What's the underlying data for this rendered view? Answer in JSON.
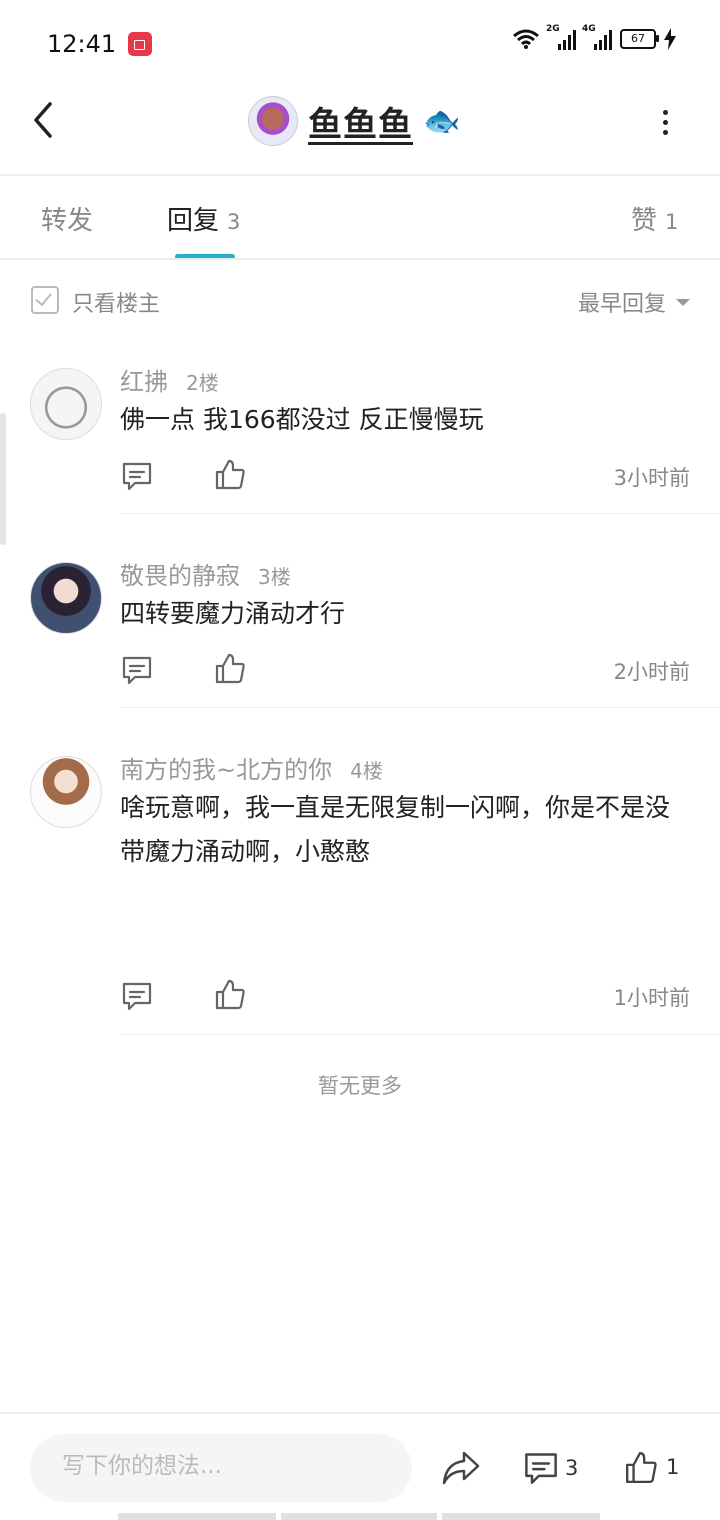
{
  "status": {
    "time": "12:41",
    "net1": "2G",
    "net2": "4G",
    "battery": "67"
  },
  "header": {
    "title": "鱼鱼鱼",
    "emoji": "🐟"
  },
  "tabs": {
    "forward": {
      "label": "转发"
    },
    "reply": {
      "label": "回复",
      "count": "3"
    },
    "like": {
      "label": "赞",
      "count": "1"
    }
  },
  "filter": {
    "only_owner": "只看楼主",
    "sort": "最早回复"
  },
  "comments": [
    {
      "name": "红拂",
      "floor": "2楼",
      "text": "佛一点 我166都没过 反正慢慢玩",
      "time": "3小时前"
    },
    {
      "name": "敬畏的静寂",
      "floor": "3楼",
      "text": "四转要魔力涌动才行",
      "time": "2小时前"
    },
    {
      "name": "南方的我~北方的你",
      "floor": "4楼",
      "text": "啥玩意啊，我一直是无限复制一闪啊，你是不是没带魔力涌动啊，小憨憨",
      "time": "1小时前"
    }
  ],
  "no_more": "暂无更多",
  "bottom": {
    "placeholder": "写下你的想法...",
    "comment_count": "3",
    "like_count": "1"
  },
  "colors": {
    "accent": "#27b1c6",
    "record": "#e8394a"
  },
  "icons": [
    "back-arrow-icon",
    "more-dots-icon",
    "comment-icon",
    "like-icon",
    "share-icon",
    "checkbox-icon",
    "dropdown-triangle-icon"
  ]
}
